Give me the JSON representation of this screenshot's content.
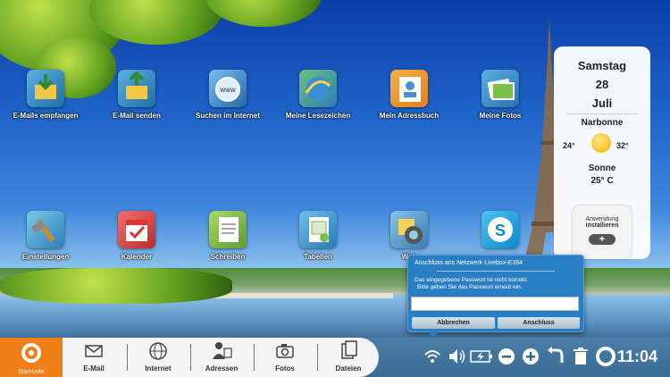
{
  "apps": [
    {
      "label": "E-Mails empfangen",
      "icon": "email-receive-icon"
    },
    {
      "label": "E-Mail senden",
      "icon": "email-send-icon"
    },
    {
      "label": "Suchen im Internet",
      "icon": "web-search-icon"
    },
    {
      "label": "Meine Lesezeichen",
      "icon": "bookmarks-icon"
    },
    {
      "label": "Mein Adressbuch",
      "icon": "address-book-icon"
    },
    {
      "label": "Meine Fotos",
      "icon": "photos-icon"
    },
    {
      "label": "Einstellungen",
      "icon": "settings-icon"
    },
    {
      "label": "Kalender",
      "icon": "calendar-icon"
    },
    {
      "label": "Schreiben",
      "icon": "write-icon"
    },
    {
      "label": "Tabellen",
      "icon": "spreadsheet-icon"
    },
    {
      "label": "Web",
      "icon": "webcam-icon"
    },
    {
      "label": "",
      "icon": "skype-icon"
    }
  ],
  "weather": {
    "day": "Samstag",
    "date": "28",
    "month": "Juli",
    "city": "Narbonne",
    "min": "24°",
    "max": "32°",
    "condition": "Sonne",
    "current": "25° C"
  },
  "install": {
    "line1": "Anwendung",
    "line2": "installieren"
  },
  "wifi_popup": {
    "title": "Anschluss ans Netzwerk Livebox-E394",
    "message1": "Das eingegebene Passwort ist nicht korrekt.",
    "message2": "Bitte geben Sie das Passwort erneut ein.",
    "password_value": "",
    "cancel": "Abbrechen",
    "connect": "Anschluss"
  },
  "dock": {
    "start": "Startseite",
    "items": [
      "E-Mail",
      "Internet",
      "Adressen",
      "Fotos",
      "Dateien"
    ]
  },
  "tray": {
    "time": "11:04"
  },
  "colors": {
    "accent": "#f07f17",
    "popup": "#2a7fc4",
    "taskbar": "#3a6b93"
  }
}
